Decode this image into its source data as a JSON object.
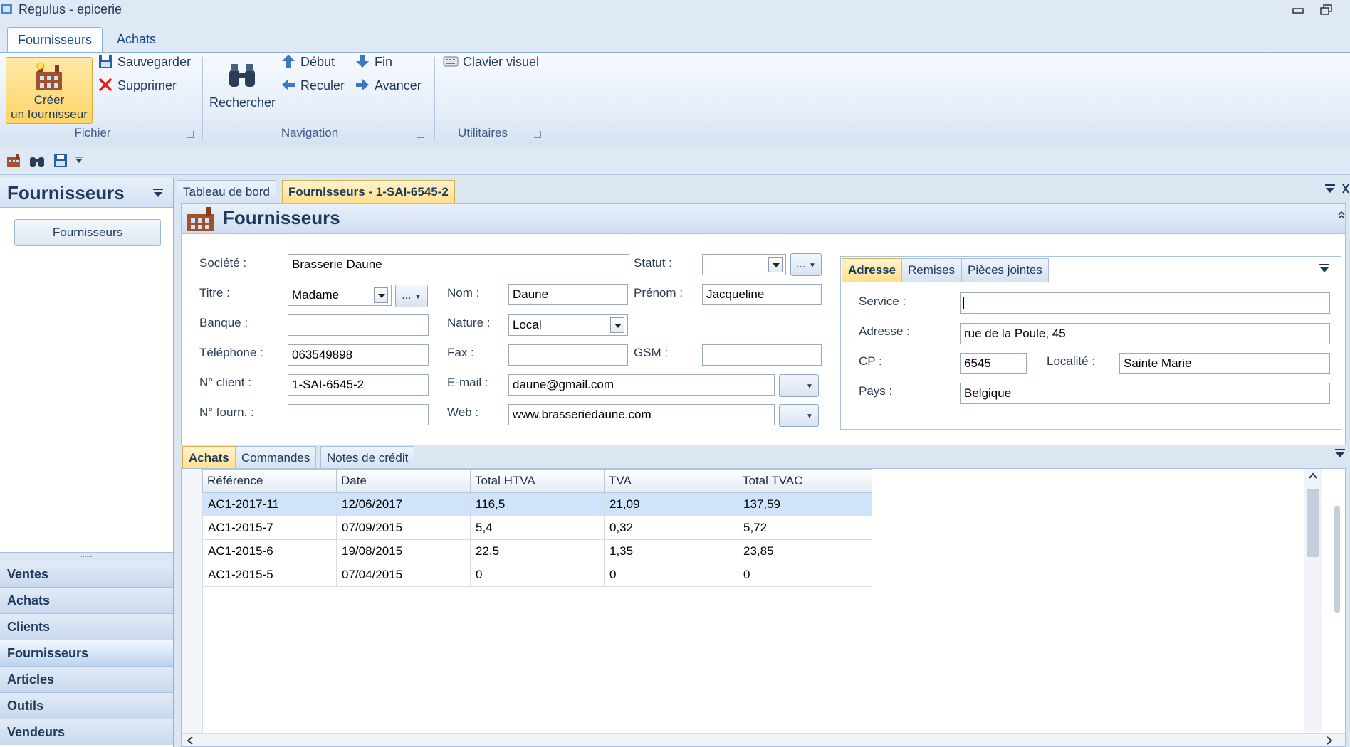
{
  "window": {
    "title": "Regulus - epicerie"
  },
  "ribbon": {
    "tabs": [
      "Fournisseurs",
      "Achats"
    ],
    "groups": {
      "fichier": {
        "label": "Fichier",
        "create_label_1": "Créer",
        "create_label_2": "un fournisseur",
        "save": "Sauvegarder",
        "delete": "Supprimer"
      },
      "navigation": {
        "label": "Navigation",
        "search": "Rechercher",
        "first": "Début",
        "last": "Fin",
        "back": "Reculer",
        "forward": "Avancer"
      },
      "utilitaires": {
        "label": "Utilitaires",
        "keyboard": "Clavier visuel"
      }
    }
  },
  "leftnav": {
    "title": "Fournisseurs",
    "sub_item": "Fournisseurs",
    "grip": "......",
    "sections": [
      "Ventes",
      "Achats",
      "Clients",
      "Fournisseurs",
      "Articles",
      "Outils",
      "Vendeurs"
    ],
    "active_section": "Fournisseurs"
  },
  "doc_tabs": [
    "Tableau de bord",
    "Fournisseurs - 1-SAI-6545-2"
  ],
  "panel": {
    "title": "Fournisseurs"
  },
  "form": {
    "societe_label": "Société :",
    "societe": "Brasserie Daune",
    "statut_label": "Statut :",
    "statut": "",
    "titre_label": "Titre :",
    "titre": "Madame",
    "nom_label": "Nom :",
    "nom": "Daune",
    "prenom_label": "Prénom :",
    "prenom": "Jacqueline",
    "banque_label": "Banque :",
    "banque": "",
    "nature_label": "Nature :",
    "nature": "Local",
    "telephone_label": "Téléphone :",
    "telephone": "063549898",
    "fax_label": "Fax :",
    "fax": "",
    "gsm_label": "GSM :",
    "gsm": "",
    "nclient_label": "N° client :",
    "nclient": "1-SAI-6545-2",
    "email_label": "E-mail :",
    "email": "daune@gmail.com",
    "nfourn_label": "N° fourn. :",
    "nfourn": "",
    "web_label": "Web :",
    "web": "www.brasseriedaune.com",
    "ellipsis": "..."
  },
  "address": {
    "tabs": [
      "Adresse",
      "Remises",
      "Pièces jointes"
    ],
    "service_label": "Service :",
    "service": "",
    "adresse_label": "Adresse :",
    "adresse": "rue de la Poule, 45",
    "cp_label": "CP :",
    "cp": "6545",
    "localite_label": "Localité :",
    "localite": "Sainte Marie",
    "pays_label": "Pays :",
    "pays": "Belgique"
  },
  "bottom_tabs": [
    "Achats",
    "Commandes",
    "Notes de crédit"
  ],
  "grid": {
    "columns": [
      "Référence",
      "Date",
      "Total HTVA",
      "TVA",
      "Total TVAC"
    ],
    "rows": [
      [
        "AC1-2017-11",
        "12/06/2017",
        "116,5",
        "21,09",
        "137,59"
      ],
      [
        "AC1-2015-7",
        "07/09/2015",
        "5,4",
        "0,32",
        "5,72"
      ],
      [
        "AC1-2015-6",
        "19/08/2015",
        "22,5",
        "1,35",
        "23,85"
      ],
      [
        "AC1-2015-5",
        "07/04/2015",
        "0",
        "0",
        "0"
      ]
    ],
    "selected_row": 0
  },
  "colors": {
    "accent": "#ffd467",
    "frame": "#8db2e3",
    "selection": "#cfe3fb"
  }
}
